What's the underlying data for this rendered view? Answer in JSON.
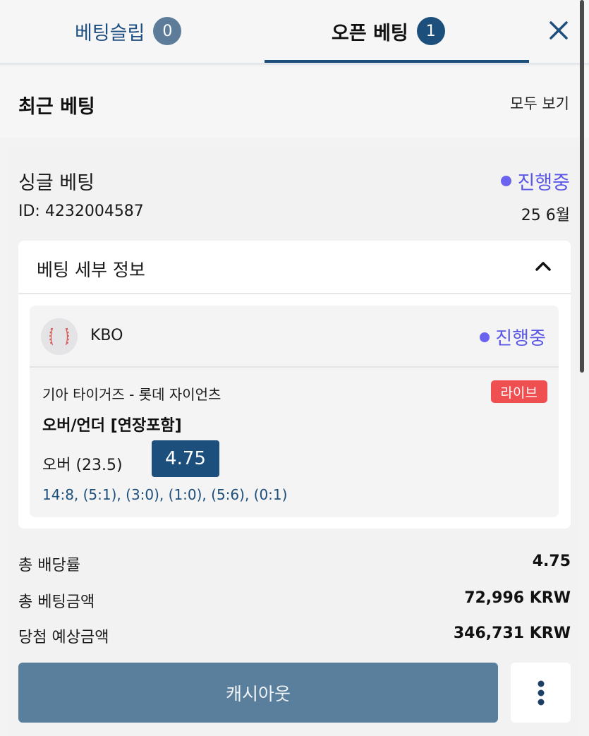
{
  "tabs": {
    "betslip_label": "베팅슬립",
    "betslip_count": "0",
    "open_bets_label": "오픈 베팅",
    "open_bets_count": "1",
    "close_icon": "close-icon"
  },
  "recent": {
    "title": "최근 베팅",
    "view_all": "모두 보기"
  },
  "bet": {
    "type": "싱글 베팅",
    "status": "진행중",
    "id": "ID: 4232004587",
    "date": "25 6월",
    "details_title": "베팅 세부 정보",
    "event": {
      "league": "KBO",
      "status": "진행중",
      "teams": "기아 타이거즈 - 롯데 자이언츠",
      "live_label": "라이브",
      "market": "오버/언더 [연장포함]",
      "selection": "오버 (23.5)",
      "odds": "4.75",
      "scores": "14:8, (5:1), (3:0), (1:0), (5:6), (0:1)"
    },
    "totals": {
      "total_odds_label": "총 배당률",
      "total_odds_value": "4.75",
      "stake_label": "총 베팅금액",
      "stake_value": "72,996 KRW",
      "potential_label": "당첨 예상금액",
      "potential_value": "346,731 KRW"
    },
    "cashout_label": "캐시아웃"
  },
  "colors": {
    "navy": "#1d4f7c",
    "status_purple": "#5a57e6",
    "live_red": "#f04f52",
    "cashout": "#5a7f9c"
  }
}
